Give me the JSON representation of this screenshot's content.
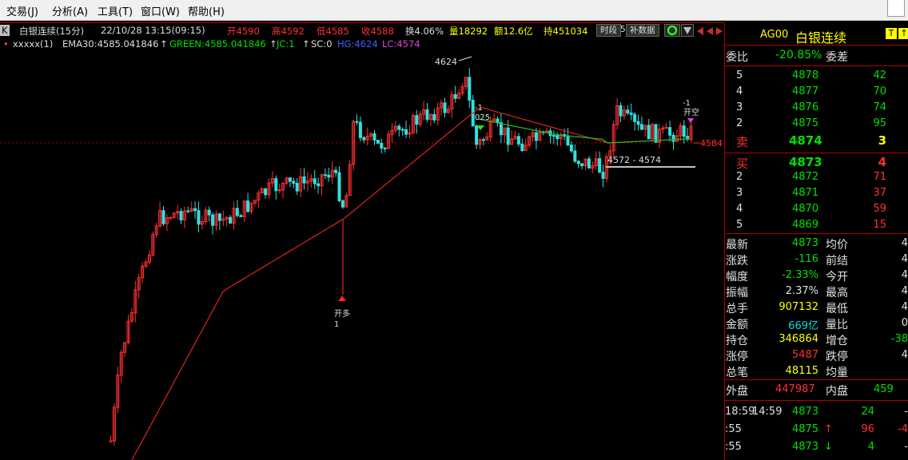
{
  "menu": [
    "交易(J)",
    "分析(A)",
    "工具(T)",
    "窗口(W)",
    "帮助(H)"
  ],
  "header": {
    "k_btn": "K",
    "title": "白银连续(15分)",
    "datetime": "22/10/28 13:15(09:15)",
    "open": "开4590",
    "high": "高4592",
    "low": "低4585",
    "close": "收4588",
    "turnover": "换4.06%",
    "volume": "量18292",
    "amount": "额12.6亿",
    "hold": "持451034",
    "btn_period": "时段",
    "btn_period_num": "5",
    "btn_fill": "补数据"
  },
  "indicator": {
    "name": "xxxxx(1)",
    "ema": "EMA30:4585.041846",
    "green": "GREEN:4585.041846",
    "jc": "JC:1",
    "sc": "SC:0",
    "hg": "HG:4624",
    "lc": "LC:4574"
  },
  "chart_data": {
    "type": "candlestick",
    "annotations": {
      "high_label": "4624",
      "open_long": "开多",
      "open_long_num": "1",
      "mark_neg1_a": "-1",
      "mark_025": "025",
      "mark_neg1_b": "-1",
      "mark_open_short": "开空",
      "range_label": "4572 - 4574",
      "price_tag": "4584"
    }
  },
  "quote_panel": {
    "symbol": "AG00",
    "name": "白银连续",
    "weibi_label": "委比",
    "weibi_value": "-20.85%",
    "weicha_label": "委差",
    "sell": [
      {
        "level": "5",
        "price": "4878",
        "qty": "42"
      },
      {
        "level": "4",
        "price": "4877",
        "qty": "70"
      },
      {
        "level": "3",
        "price": "4876",
        "qty": "74"
      },
      {
        "level": "2",
        "price": "4875",
        "qty": "95"
      },
      {
        "level": "卖",
        "price": "4874",
        "qty": "3"
      }
    ],
    "buy": [
      {
        "level": "买",
        "price": "4873",
        "qty": "4"
      },
      {
        "level": "2",
        "price": "4872",
        "qty": "71"
      },
      {
        "level": "3",
        "price": "4871",
        "qty": "37"
      },
      {
        "level": "4",
        "price": "4870",
        "qty": "59"
      },
      {
        "level": "5",
        "price": "4869",
        "qty": "15"
      }
    ],
    "stats": [
      {
        "l1": "最新",
        "v1": "4873",
        "l2": "均价",
        "v2": "4"
      },
      {
        "l1": "涨跌",
        "v1": "-116",
        "l2": "前结",
        "v2": "4"
      },
      {
        "l1": "幅度",
        "v1": "-2.33%",
        "l2": "今开",
        "v2": "4"
      },
      {
        "l1": "振幅",
        "v1": "2.37%",
        "l2": "最高",
        "v2": "4"
      },
      {
        "l1": "总手",
        "v1": "907132",
        "l2": "最低",
        "v2": "4"
      },
      {
        "l1": "金额",
        "v1": "669亿",
        "l2": "量比",
        "v2": "0"
      },
      {
        "l1": "持仓",
        "v1": "346864",
        "l2": "增仓",
        "v2": "-38"
      },
      {
        "l1": "涨停",
        "v1": "5487",
        "l2": "跌停",
        "v2": "4"
      },
      {
        "l1": "总笔",
        "v1": "48115",
        "l2": "均量",
        "v2": ""
      }
    ],
    "outer_label": "外盘",
    "outer_value": "447987",
    "inner_label": "内盘",
    "inner_value": "459",
    "ticks": [
      {
        "time": "18:59",
        "time2": "14:59",
        "price": "4873",
        "arrow": "",
        "vol": "24",
        "chg": "-"
      },
      {
        "time": ":55",
        "time2": "",
        "price": "4875",
        "arrow": "↑",
        "vol": "96",
        "chg": "-4"
      },
      {
        "time": ":55",
        "time2": "",
        "price": "4873",
        "arrow": "↓",
        "vol": "4",
        "chg": "-"
      }
    ],
    "flag_t": "T",
    "flag_up": "↑"
  }
}
